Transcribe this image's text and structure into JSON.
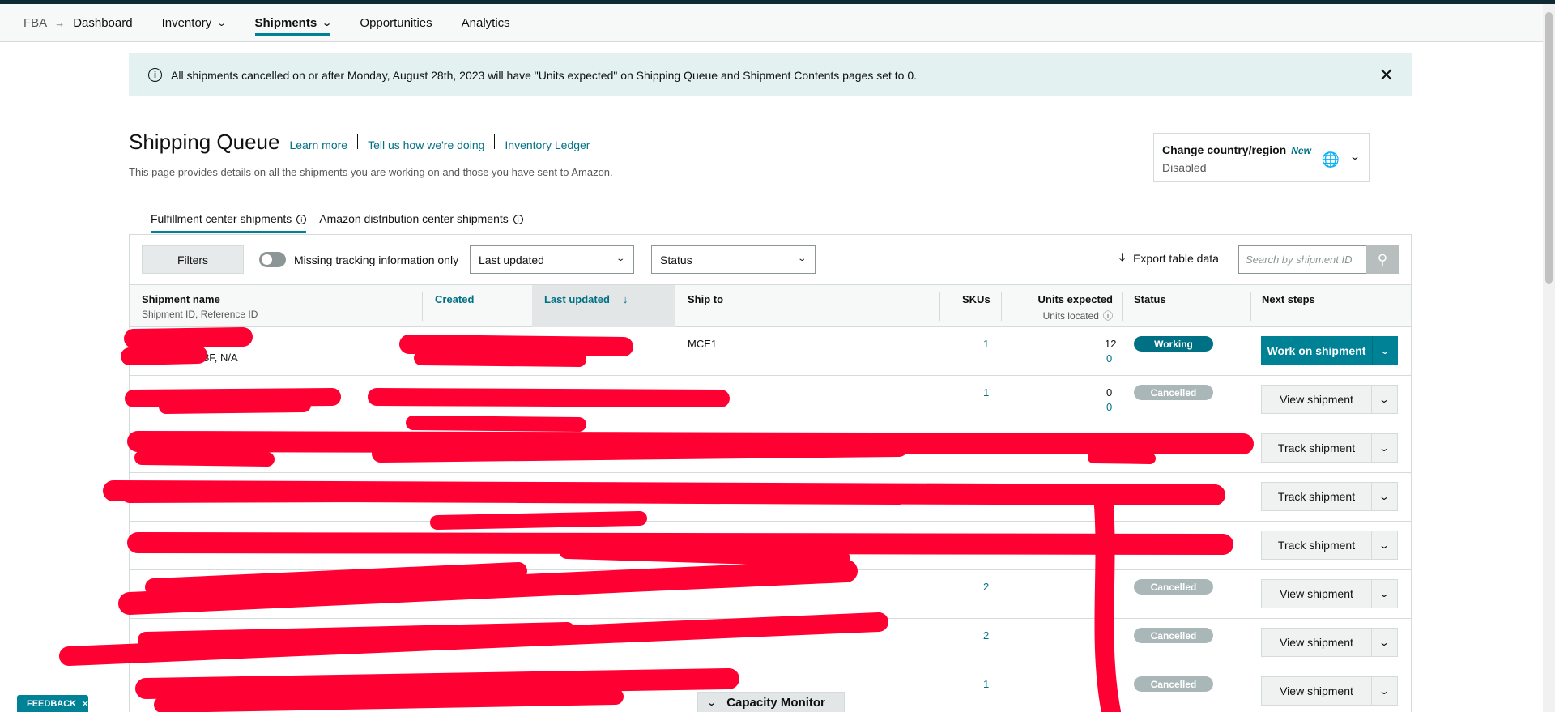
{
  "nav": {
    "crumb": "FBA",
    "items": [
      {
        "label": "Dashboard"
      },
      {
        "label": "Inventory"
      },
      {
        "label": "Shipments"
      },
      {
        "label": "Opportunities"
      },
      {
        "label": "Analytics"
      }
    ]
  },
  "banner": {
    "text": "All shipments cancelled on or after Monday, August 28th, 2023 will have \"Units expected\" on Shipping Queue and Shipment Contents pages set to 0."
  },
  "header": {
    "title": "Shipping Queue",
    "links": [
      "Learn more",
      "Tell us how we're doing",
      "Inventory Ledger"
    ],
    "subtitle": "This page provides details on all the shipments you are working on and those you have sent to Amazon."
  },
  "country": {
    "label": "Change country/region",
    "badge": "New",
    "value": "Disabled"
  },
  "tabs": [
    "Fulfillment center shipments",
    "Amazon distribution center shipments"
  ],
  "toolbar": {
    "filters": "Filters",
    "toggle_label": "Missing tracking information only",
    "sort_select": "Last updated",
    "status_select": "Status",
    "export": "Export table data",
    "search_placeholder": "Search by shipment ID"
  },
  "columns": {
    "name": "Shipment name",
    "name_sub": "Shipment ID, Reference ID",
    "created": "Created",
    "updated": "Last updated",
    "ship_to": "Ship to",
    "skus": "SKUs",
    "units": "Units expected",
    "units_sub": "Units located",
    "status": "Status",
    "next": "Next steps"
  },
  "rows": [
    {
      "name_sub": "8F, N/A",
      "ship_to": "MCE1",
      "skus": "1",
      "units_expected": "12",
      "units_located": "0",
      "status": "Working",
      "action": "Work on shipment"
    },
    {
      "skus": "1",
      "units_expected": "0",
      "units_located": "0",
      "status": "Cancelled",
      "action": "View shipment"
    },
    {
      "action": "Track shipment"
    },
    {
      "action": "Track shipment"
    },
    {
      "action": "Track shipment"
    },
    {
      "skus": "2",
      "status": "Cancelled",
      "action": "View shipment"
    },
    {
      "skus": "2",
      "status": "Cancelled",
      "action": "View shipment"
    },
    {
      "skus": "1",
      "status": "Cancelled",
      "action": "View shipment"
    }
  ],
  "footer": {
    "feedback": "FEEDBACK",
    "capacity": "Capacity Monitor"
  }
}
